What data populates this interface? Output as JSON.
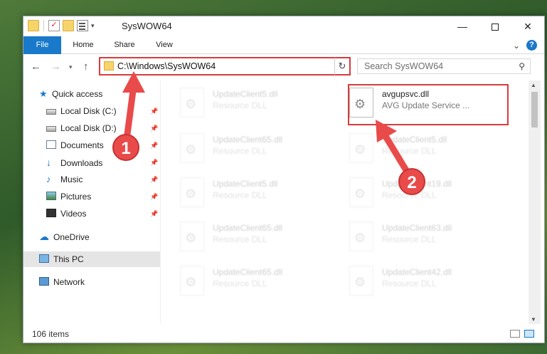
{
  "window": {
    "title": "SysWOW64",
    "min_glyph": "—",
    "close_glyph": "✕"
  },
  "ribbon": {
    "tabs": [
      {
        "label": "File"
      },
      {
        "label": "Home"
      },
      {
        "label": "Share"
      },
      {
        "label": "View"
      }
    ],
    "help": "?"
  },
  "address": {
    "path": "C:\\Windows\\SysWOW64"
  },
  "search": {
    "placeholder": "Search SysWOW64"
  },
  "sidebar": {
    "items": [
      {
        "label": "Quick access",
        "icon": "star-icon"
      },
      {
        "label": "Local Disk (C:)",
        "icon": "disk-icon",
        "pinned": true
      },
      {
        "label": "Local Disk (D:)",
        "icon": "disk-icon",
        "pinned": true
      },
      {
        "label": "Documents",
        "icon": "document-icon",
        "pinned": true
      },
      {
        "label": "Downloads",
        "icon": "download-icon",
        "pinned": true
      },
      {
        "label": "Music",
        "icon": "music-icon",
        "pinned": true
      },
      {
        "label": "Pictures",
        "icon": "picture-icon",
        "pinned": true
      },
      {
        "label": "Videos",
        "icon": "video-icon",
        "pinned": true
      },
      {
        "label": "OneDrive",
        "icon": "cloud-icon"
      },
      {
        "label": "This PC",
        "icon": "computer-icon",
        "selected": true
      },
      {
        "label": "Network",
        "icon": "network-icon"
      }
    ]
  },
  "files": [
    {
      "name": "UpdateClient5.dll",
      "desc": "Resource DLL"
    },
    {
      "name": "avgupsvc.dll",
      "desc": "AVG Update Service ..."
    },
    {
      "name": "UpdateClient65.dll",
      "desc": "Resource DLL"
    },
    {
      "name": "UpdateClient5.dll",
      "desc": "Resource DLL"
    },
    {
      "name": "UpdateClient5.dll",
      "desc": "Resource DLL"
    },
    {
      "name": "UpdateClient19.dll",
      "desc": "Resource DLL"
    },
    {
      "name": "UpdateClient65.dll",
      "desc": "Resource DLL"
    },
    {
      "name": "UpdateClient63.dll",
      "desc": "Resource DLL"
    },
    {
      "name": "UpdateClient65.dll",
      "desc": "Resource DLL"
    },
    {
      "name": "UpdateClient42.dll",
      "desc": "Resource DLL"
    }
  ],
  "status": {
    "count": "106 items"
  },
  "callouts": {
    "one": "1",
    "two": "2"
  },
  "colors": {
    "accent": "#1979ca",
    "highlight": "#d83b3b"
  }
}
